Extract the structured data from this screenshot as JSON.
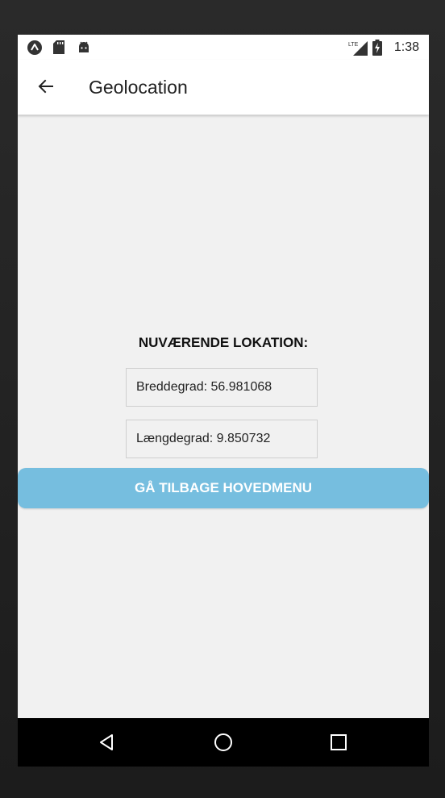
{
  "status_bar": {
    "time": "1:38",
    "left_icons": [
      "expo-icon",
      "sd-card-icon",
      "android-icon"
    ],
    "right_icons": [
      "lte-signal-icon",
      "battery-charging-icon"
    ],
    "lte_label": "LTE"
  },
  "app_bar": {
    "title": "Geolocation",
    "back_icon": "arrow-back-icon"
  },
  "main": {
    "heading": "NUVÆRENDE LOKATION:",
    "latitude_text": "Breddegrad: 56.981068",
    "longitude_text": "Længdegrad: 9.850732",
    "back_button_label": "GÅ TILBAGE HOVEDMENU"
  },
  "nav_bar": {
    "icons": [
      "nav-back-icon",
      "nav-home-icon",
      "nav-recents-icon"
    ]
  },
  "colors": {
    "button": "#76bedf",
    "background": "#f1f1f1",
    "app_bar": "#ffffff",
    "nav_bar": "#000000"
  }
}
